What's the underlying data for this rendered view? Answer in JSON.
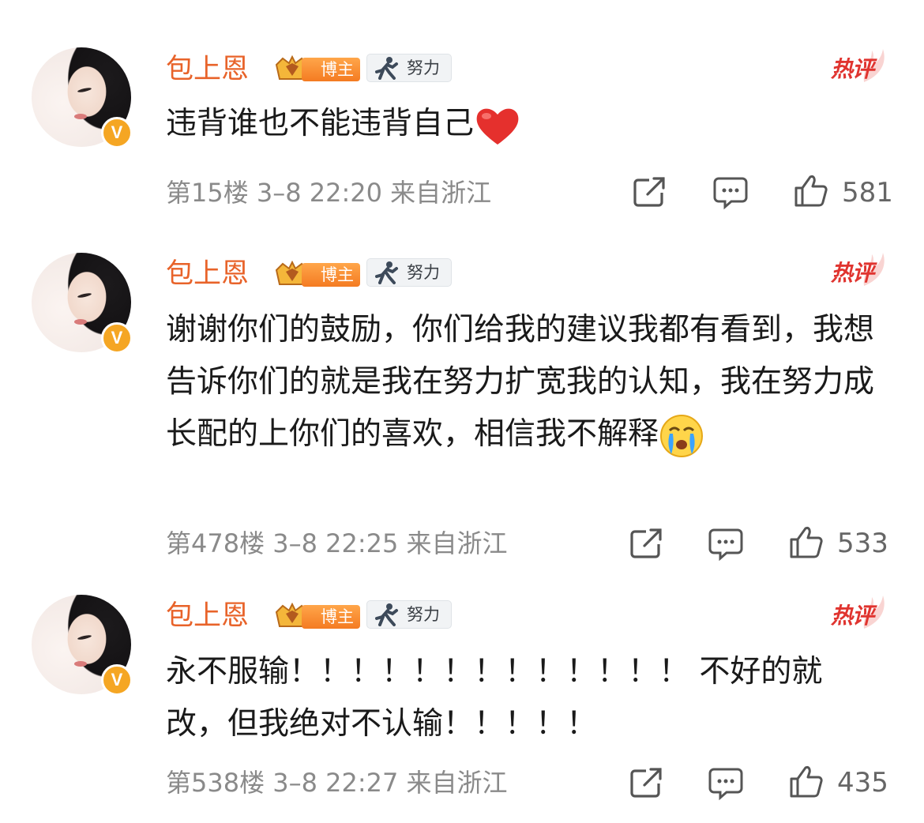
{
  "comments": [
    {
      "username": "包上恩",
      "badge_blogger": "博主",
      "badge_effort": "努力",
      "hot_label": "热评",
      "content": "违背谁也不能违背自己",
      "emoji": "red-heart",
      "meta": "第15楼 3–8 22:20 来自浙江",
      "likes": "581"
    },
    {
      "username": "包上恩",
      "badge_blogger": "博主",
      "badge_effort": "努力",
      "hot_label": "热评",
      "content": "谢谢你们的鼓励，你们给我的建议我都有看到，我想告诉你们的就是我在努力扩宽我的认知，我在努力成长配的上你们的喜欢，相信我不解释",
      "emoji": "crying-face",
      "meta": "第478楼 3–8 22:25 来自浙江",
      "likes": "533"
    },
    {
      "username": "包上恩",
      "badge_blogger": "博主",
      "badge_effort": "努力",
      "hot_label": "热评",
      "content": "永不服输！！！！！！！！！！！！！ 不好的就改，但我绝对不认输！！！！！",
      "emoji": "",
      "meta": "第538楼 3–8 22:27 来自浙江",
      "likes": "435"
    }
  ],
  "icons": {
    "verified": "V",
    "share": "share-icon",
    "comment": "comment-icon",
    "like": "thumbs-up-icon"
  },
  "colors": {
    "username": "#e8632a",
    "hot": "#e0342f",
    "verified_badge": "#f5a623",
    "meta": "#8a8a8a"
  }
}
